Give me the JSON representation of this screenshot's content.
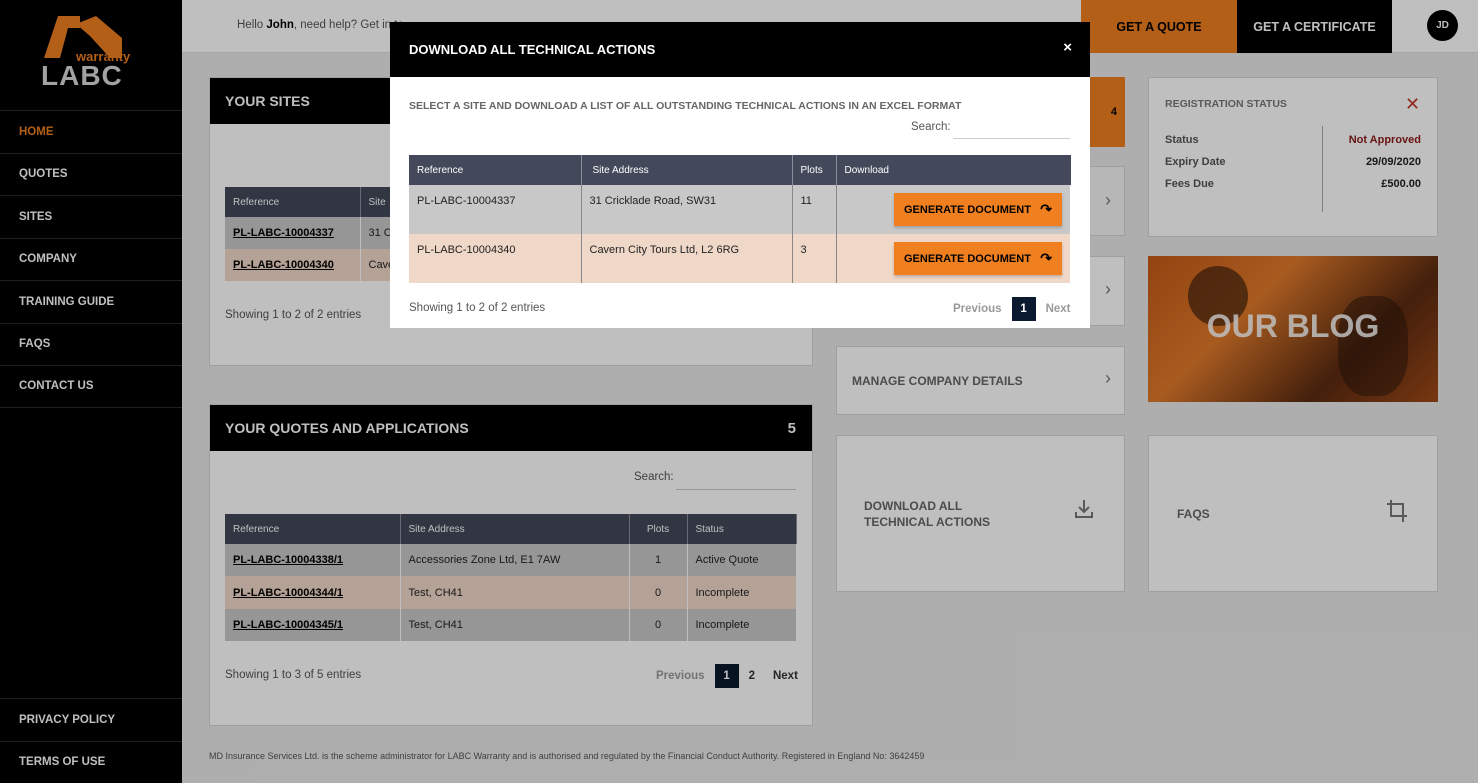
{
  "brand": {
    "logo_text": "warranty",
    "logo_main": "LABC",
    "accent": "#f07f1f"
  },
  "sidebar": {
    "items": [
      {
        "label": "HOME"
      },
      {
        "label": "QUOTES"
      },
      {
        "label": "SITES"
      },
      {
        "label": "COMPANY"
      },
      {
        "label": "TRAINING GUIDE"
      },
      {
        "label": "FAQS"
      },
      {
        "label": "CONTACT US"
      }
    ],
    "bottom_items": [
      {
        "label": "PRIVACY POLICY"
      },
      {
        "label": "TERMS OF USE"
      }
    ]
  },
  "topbar": {
    "hello_prefix": "Hello ",
    "user_name": "John",
    "hello_suffix": ", need help? Get in to",
    "quote_btn": "GET A QUOTE",
    "cert_btn": "GET A CERTIFICATE",
    "avatar": "JD"
  },
  "sites": {
    "title": "YOUR SITES",
    "header_ref": "Reference",
    "header_site": "Site",
    "rows": [
      {
        "ref": "PL-LABC-10004337",
        "site": "31 C"
      },
      {
        "ref": "PL-LABC-10004340",
        "site": "Cave"
      }
    ],
    "info": "Showing 1 to 2 of 2 entries",
    "count_fragment": "4"
  },
  "quotes": {
    "title": "YOUR QUOTES AND APPLICATIONS",
    "count": "5",
    "search_label": "Search:",
    "headers": [
      "Reference",
      "Site Address",
      "Plots",
      "Status"
    ],
    "rows": [
      {
        "ref": "PL-LABC-10004338/1",
        "address": "Accessories Zone Ltd, E1 7AW",
        "plots": "1",
        "status": "Active Quote"
      },
      {
        "ref": "PL-LABC-10004344/1",
        "address": "Test, CH41",
        "plots": "0",
        "status": "Incomplete"
      },
      {
        "ref": "PL-LABC-10004345/1",
        "address": "Test, CH41",
        "plots": "0",
        "status": "Incomplete"
      }
    ],
    "info": "Showing 1 to 3 of 5 entries",
    "pager": {
      "prev": "Previous",
      "page1": "1",
      "page2": "2",
      "next": "Next"
    }
  },
  "registration": {
    "title": "REGISTRATION STATUS",
    "rows": [
      {
        "label": "Status",
        "value": "Not Approved"
      },
      {
        "label": "Expiry Date",
        "value": "29/09/2020"
      },
      {
        "label": "Fees Due",
        "value": "£500.00"
      }
    ]
  },
  "cards": {
    "manage_company": "MANAGE COMPANY DETAILS",
    "download_actions": "DOWNLOAD ALL TECHNICAL ACTIONS",
    "faqs": "FAQS",
    "blog": "OUR BLOG"
  },
  "footer": {
    "text": "MD Insurance Services Ltd. is the scheme administrator for LABC Warranty and is authorised and regulated by the Financial Conduct Authority. Registered in England No: 3642459"
  },
  "modal": {
    "title": "DOWNLOAD ALL TECHNICAL ACTIONS",
    "close": "×",
    "subtitle": "SELECT A SITE AND DOWNLOAD A LIST OF ALL OUTSTANDING TECHNICAL ACTIONS IN AN EXCEL FORMAT",
    "search_label": "Search:",
    "headers": [
      "Reference",
      "Site Address",
      "Plots",
      "Download"
    ],
    "rows": [
      {
        "ref": "PL-LABC-10004337",
        "address": "31 Cricklade Road, SW31",
        "plots": "11",
        "btn": "GENERATE DOCUMENT"
      },
      {
        "ref": "PL-LABC-10004340",
        "address": "Cavern City Tours Ltd, L2 6RG",
        "plots": "3",
        "btn": "GENERATE DOCUMENT"
      }
    ],
    "info": "Showing 1 to 2 of 2 entries",
    "pager": {
      "prev": "Previous",
      "page1": "1",
      "next": "Next"
    }
  }
}
